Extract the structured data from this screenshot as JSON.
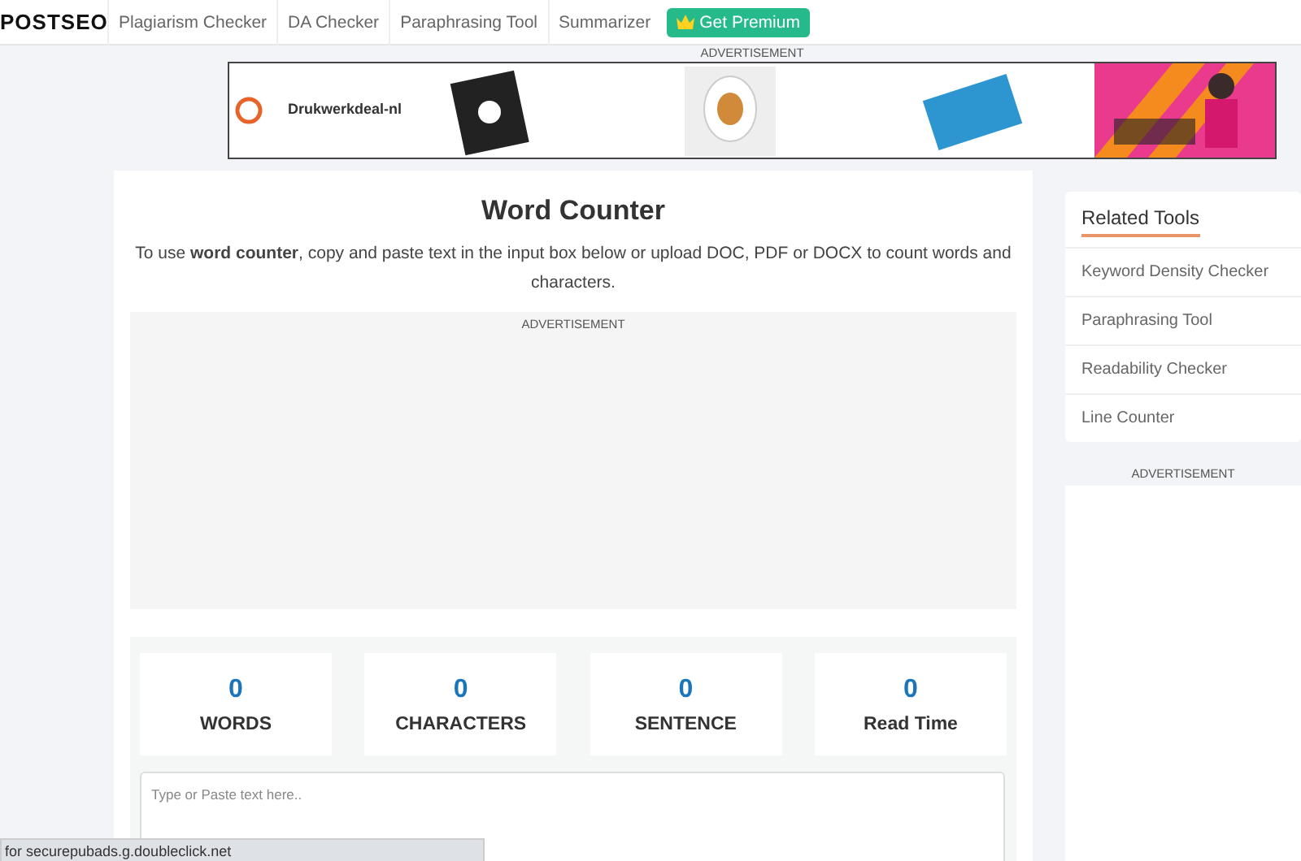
{
  "nav": {
    "logo": "POSTSEO",
    "links": [
      "Plagiarism Checker",
      "DA Checker",
      "Paraphrasing Tool",
      "Summarizer"
    ],
    "premium": "Get Premium"
  },
  "top_ad": {
    "label": "ADVERTISEMENT",
    "brand": "Drukwerkdeal-nl"
  },
  "main": {
    "title": "Word Counter",
    "intro": "To use **word counter**, copy and paste text in the input box below or upload DOC, PDF or DOCX to count words and characters.",
    "ad_label": "ADVERTISEMENT",
    "stats": [
      {
        "value": "0",
        "label": "WORDS"
      },
      {
        "value": "0",
        "label": "CHARACTERS"
      },
      {
        "value": "0",
        "label": "SENTENCE"
      },
      {
        "value": "0",
        "label": "Read Time"
      }
    ],
    "input": {
      "placeholder": "Type or Paste text here.."
    }
  },
  "sidebar": {
    "title": "Related Tools",
    "items": [
      "Keyword Density Checker",
      "Paraphrasing Tool",
      "Readability Checker",
      "Line Counter"
    ],
    "ad_label": "ADVERTISEMENT"
  },
  "status_bar": "for securepubads.g.doubleclick.net"
}
